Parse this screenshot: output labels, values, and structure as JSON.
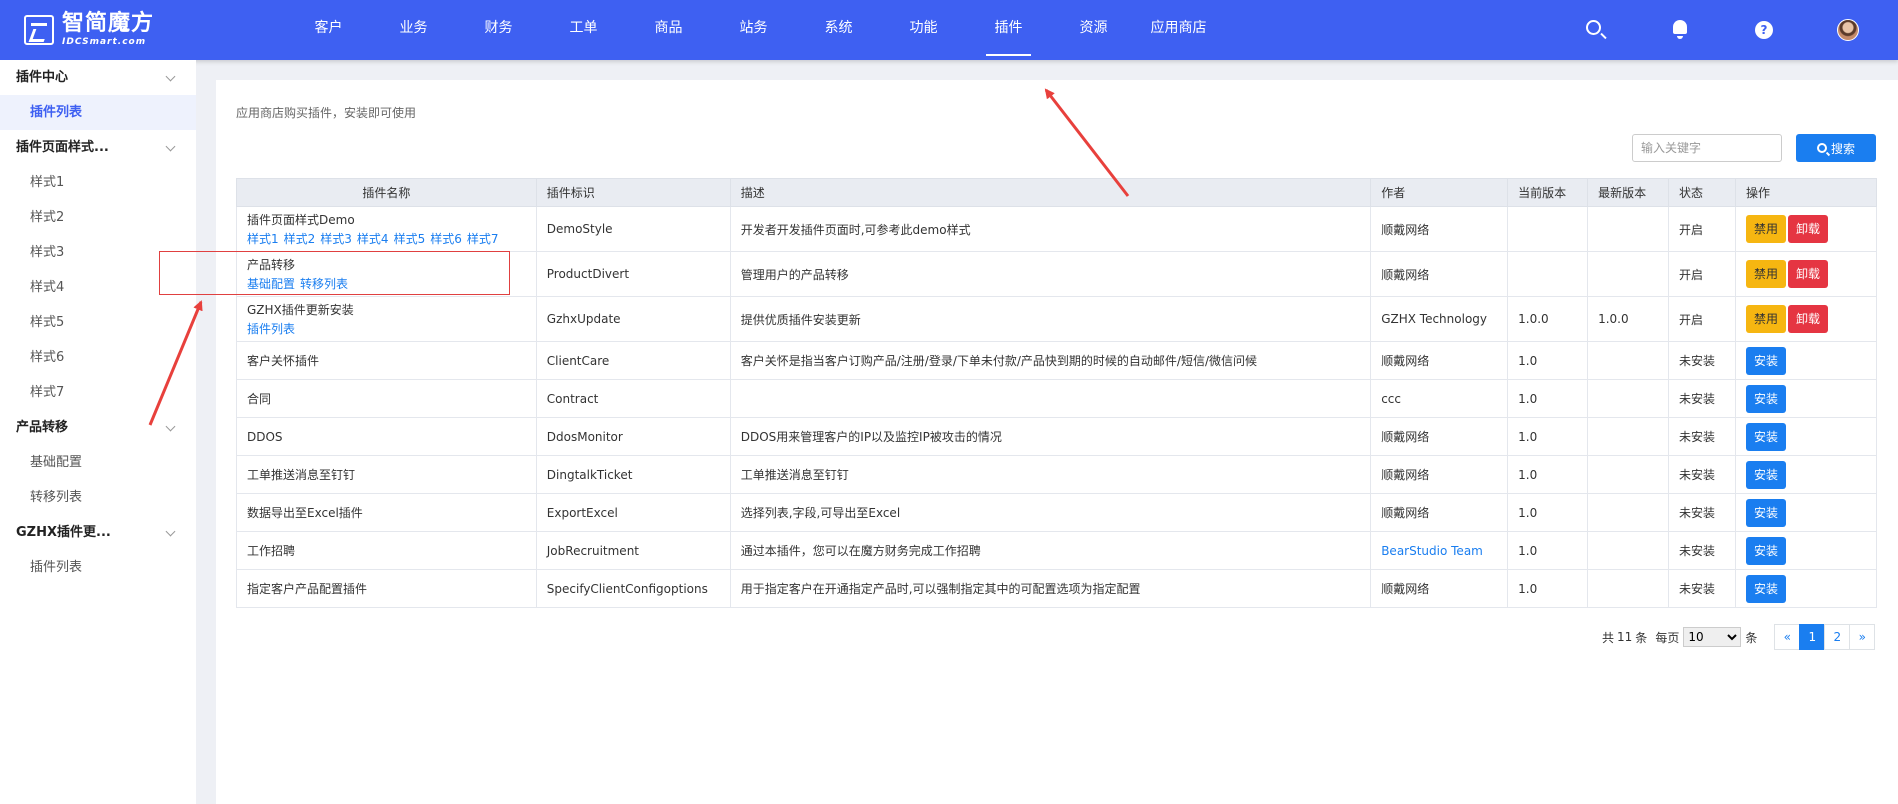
{
  "brand": {
    "name": "智简魔方",
    "sub": "IDCSmart.com"
  },
  "nav": [
    {
      "label": "客户",
      "active": false
    },
    {
      "label": "业务",
      "active": false
    },
    {
      "label": "财务",
      "active": false
    },
    {
      "label": "工单",
      "active": false
    },
    {
      "label": "商品",
      "active": false
    },
    {
      "label": "站务",
      "active": false
    },
    {
      "label": "系统",
      "active": false
    },
    {
      "label": "功能",
      "active": false
    },
    {
      "label": "插件",
      "active": true
    },
    {
      "label": "资源",
      "active": false
    },
    {
      "label": "应用商店",
      "active": false
    }
  ],
  "header_icons": [
    "search-icon",
    "bell-icon",
    "help-icon",
    "avatar"
  ],
  "help_glyph": "?",
  "sidebar": {
    "groups": [
      {
        "label": "插件中心",
        "items": [
          {
            "label": "插件列表",
            "active": true
          }
        ]
      },
      {
        "label": "插件页面样式...",
        "items": [
          {
            "label": "样式1"
          },
          {
            "label": "样式2"
          },
          {
            "label": "样式3"
          },
          {
            "label": "样式4"
          },
          {
            "label": "样式5"
          },
          {
            "label": "样式6"
          },
          {
            "label": "样式7"
          }
        ]
      },
      {
        "label": "产品转移",
        "items": [
          {
            "label": "基础配置"
          },
          {
            "label": "转移列表"
          }
        ]
      },
      {
        "label": "GZHX插件更...",
        "items": [
          {
            "label": "插件列表"
          }
        ]
      }
    ]
  },
  "main": {
    "subtitle": "应用商店购买插件，安装即可使用",
    "search": {
      "placeholder": "输入关键字",
      "button_label": "搜索"
    },
    "columns": [
      "插件名称",
      "插件标识",
      "描述",
      "作者",
      "当前版本",
      "最新版本",
      "状态",
      "操作"
    ],
    "rows": [
      {
        "name": "插件页面样式Demo",
        "links": [
          "样式1",
          "样式2",
          "样式3",
          "样式4",
          "样式5",
          "样式6",
          "样式7"
        ],
        "id": "DemoStyle",
        "desc": "开发者开发插件页面时,可参考此demo样式",
        "author": "顺戴网络",
        "author_link": false,
        "cur": "",
        "latest": "",
        "status": "开启",
        "actions": [
          "禁用",
          "卸载"
        ]
      },
      {
        "name": "产品转移",
        "links": [
          "基础配置",
          "转移列表"
        ],
        "id": "ProductDivert",
        "desc": "管理用户的产品转移",
        "author": "顺戴网络",
        "author_link": false,
        "cur": "",
        "latest": "",
        "status": "开启",
        "actions": [
          "禁用",
          "卸载"
        ]
      },
      {
        "name": "GZHX插件更新安装",
        "links": [
          "插件列表"
        ],
        "id": "GzhxUpdate",
        "desc": "提供优质插件安装更新",
        "author": "GZHX Technology",
        "author_link": false,
        "cur": "1.0.0",
        "latest": "1.0.0",
        "status": "开启",
        "actions": [
          "禁用",
          "卸载"
        ]
      },
      {
        "name": "客户关怀插件",
        "links": [],
        "id": "ClientCare",
        "desc": "客户关怀是指当客户订购产品/注册/登录/下单未付款/产品快到期的时候的自动邮件/短信/微信问候",
        "author": "顺戴网络",
        "author_link": false,
        "cur": "1.0",
        "latest": "",
        "status": "未安装",
        "actions": [
          "安装"
        ]
      },
      {
        "name": "合同",
        "links": [],
        "id": "Contract",
        "desc": "",
        "author": "ccc",
        "author_link": false,
        "cur": "1.0",
        "latest": "",
        "status": "未安装",
        "actions": [
          "安装"
        ]
      },
      {
        "name": "DDOS",
        "links": [],
        "id": "DdosMonitor",
        "desc": "DDOS用来管理客户的IP以及监控IP被攻击的情况",
        "author": "顺戴网络",
        "author_link": false,
        "cur": "1.0",
        "latest": "",
        "status": "未安装",
        "actions": [
          "安装"
        ]
      },
      {
        "name": "工单推送消息至钉钉",
        "links": [],
        "id": "DingtalkTicket",
        "desc": "工单推送消息至钉钉",
        "author": "顺戴网络",
        "author_link": false,
        "cur": "1.0",
        "latest": "",
        "status": "未安装",
        "actions": [
          "安装"
        ]
      },
      {
        "name": "数据导出至Excel插件",
        "links": [],
        "id": "ExportExcel",
        "desc": "选择列表,字段,可导出至Excel",
        "author": "顺戴网络",
        "author_link": false,
        "cur": "1.0",
        "latest": "",
        "status": "未安装",
        "actions": [
          "安装"
        ]
      },
      {
        "name": "工作招聘",
        "links": [],
        "id": "JobRecruitment",
        "desc": "通过本插件，您可以在魔方财务完成工作招聘",
        "author": "BearStudio Team",
        "author_link": true,
        "cur": "1.0",
        "latest": "",
        "status": "未安装",
        "actions": [
          "安装"
        ]
      },
      {
        "name": "指定客户产品配置插件",
        "links": [],
        "id": "SpecifyClientConfigoptions",
        "desc": "用于指定客户在开通指定产品时,可以强制指定其中的可配置选项为指定配置",
        "author": "顺戴网络",
        "author_link": false,
        "cur": "1.0",
        "latest": "",
        "status": "未安装",
        "actions": [
          "安装"
        ]
      }
    ],
    "pagination": {
      "total_prefix": "共",
      "total": "11",
      "total_suffix": "条",
      "per_page_label": "每页",
      "per_page_value": "10",
      "per_page_suffix": "条",
      "prev": "«",
      "pages": [
        "1",
        "2"
      ],
      "current": "1",
      "next": "»"
    }
  },
  "annotation_color": "#e8403c"
}
